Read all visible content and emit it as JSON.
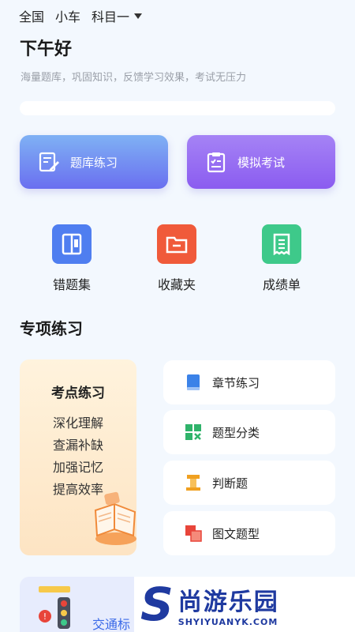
{
  "topbar": {
    "region": "全国",
    "vehicle": "小车",
    "subject": "科目一"
  },
  "greeting": "下午好",
  "subtitle": "海量题库，巩固知识，反馈学习效果，考试无压力",
  "main_buttons": {
    "practice": "题库练习",
    "mock_exam": "模拟考试"
  },
  "quick": {
    "wrong": "错题集",
    "favorites": "收藏夹",
    "scores": "成绩单"
  },
  "section_title": "专项练习",
  "kaodian": {
    "title": "考点练习",
    "points": [
      "深化理解",
      "查漏补缺",
      "加强记忆",
      "提高效率"
    ]
  },
  "special_items": [
    "章节练习",
    "题型分类",
    "判断题",
    "图文题型"
  ],
  "bottom_card": {
    "label": "交通标"
  },
  "watermark": {
    "letter": "S",
    "cn": "尚游乐园",
    "en": "SHYIYUANYK.COM"
  }
}
